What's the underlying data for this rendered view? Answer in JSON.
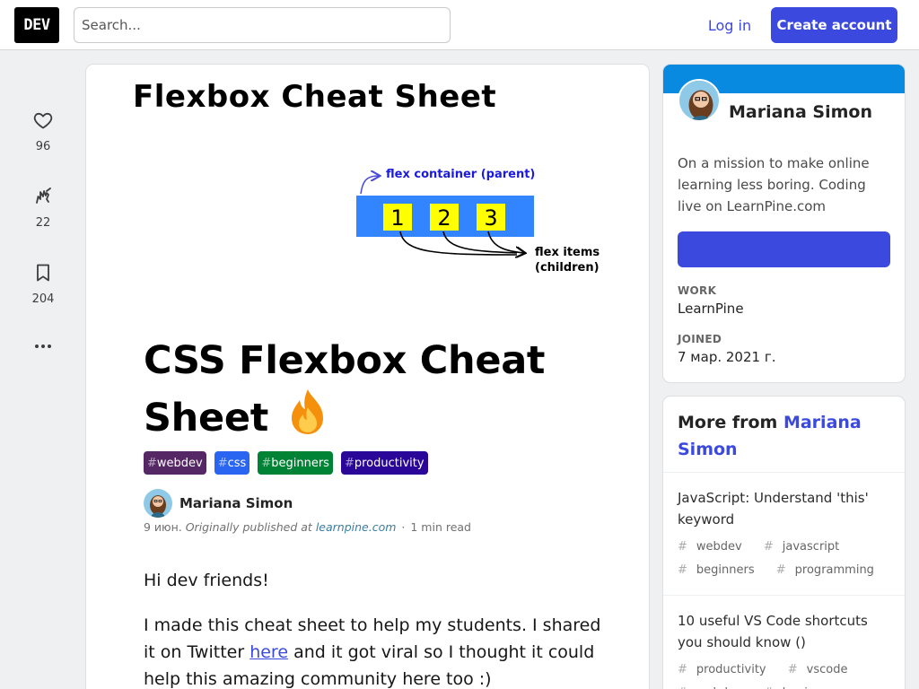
{
  "header": {
    "logo": "DEV",
    "search_placeholder": "Search...",
    "login_label": "Log in",
    "create_account_label": "Create account"
  },
  "reactions": [
    {
      "icon": "heart-icon",
      "count": "96"
    },
    {
      "icon": "unicorn-icon",
      "count": "22"
    },
    {
      "icon": "bookmark-icon",
      "count": "204"
    }
  ],
  "article": {
    "banner": {
      "title": "Flexbox Cheat Sheet",
      "container_label": "flex container (parent)",
      "items": [
        "1",
        "2",
        "3"
      ],
      "items_label_line1": "flex items",
      "items_label_line2": "(children)",
      "container_color": "#3385ff",
      "item_color": "#ffff00",
      "label_color": "#1a1ae0"
    },
    "title_line1": "CSS Flexbox Cheat",
    "title_line2": "Sheet",
    "tags": [
      {
        "name": "webdev",
        "color": "#562765"
      },
      {
        "name": "css",
        "color": "#2965f1"
      },
      {
        "name": "beginners",
        "color": "#008335"
      },
      {
        "name": "productivity",
        "color": "#2a0798"
      }
    ],
    "author": "Mariana Simon",
    "date": "9 июн.",
    "originally_published": "Originally published at",
    "source_link": "learnpine.com",
    "read_time": "1 min read",
    "paragraph1": "Hi dev friends!",
    "paragraph2_before": "I made this cheat sheet to help my students. I shared it on Twitter ",
    "paragraph2_link": "here",
    "paragraph2_after": " and it got viral so I thought it could help this amazing community here too :)"
  },
  "profile": {
    "name": "Mariana Simon",
    "bio": "On a mission to make online learning less boring. Coding live on LearnPine.com",
    "work_label": "WORK",
    "work_value": "LearnPine",
    "joined_label": "JOINED",
    "joined_value": "7 мар. 2021 г.",
    "accent_color": "#088ae0"
  },
  "more_from": {
    "prefix": "More from",
    "author": "Mariana Simon",
    "items": [
      {
        "title": "JavaScript: Understand 'this' keyword",
        "tags": [
          "webdev",
          "javascript",
          "beginners",
          "programming"
        ]
      },
      {
        "title": "10 useful VS Code shortcuts you should know ()",
        "tags": [
          "productivity",
          "vscode",
          "webdev",
          "beginners"
        ]
      }
    ]
  }
}
